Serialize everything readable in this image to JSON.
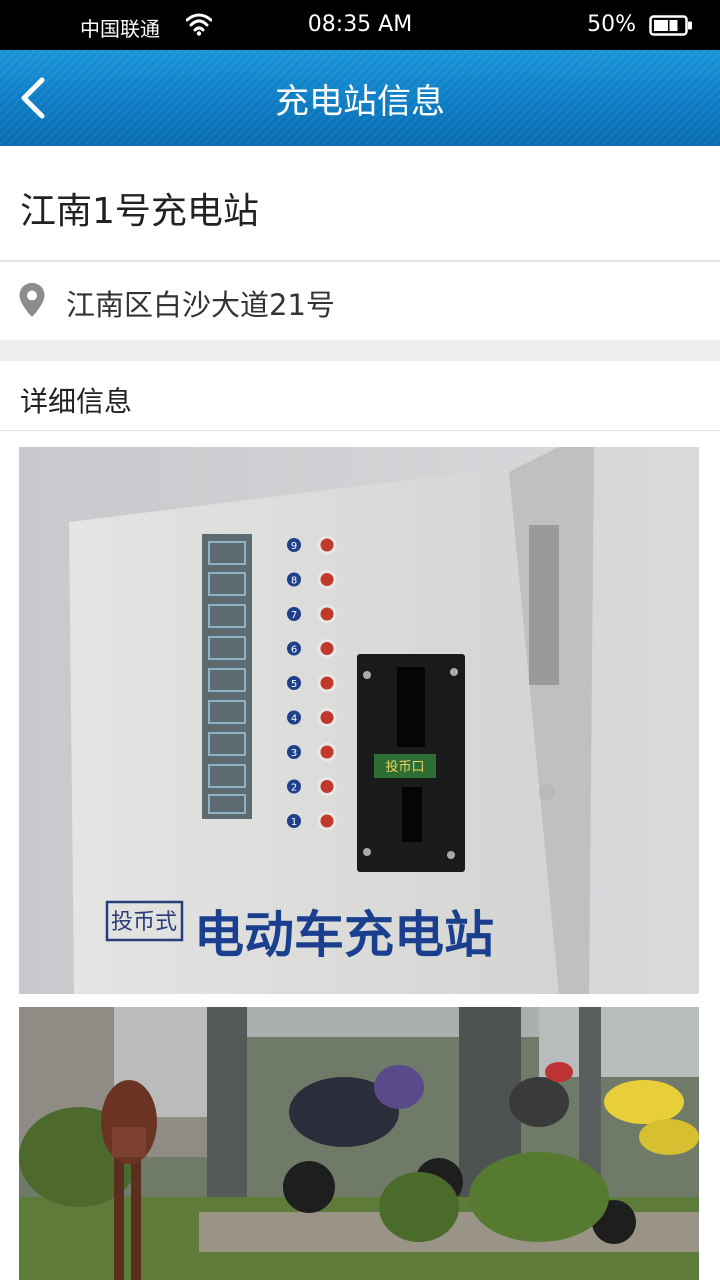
{
  "status_bar": {
    "carrier": "中国联通",
    "time": "08:35 AM",
    "battery_percent": "50%",
    "battery_level": 0.5
  },
  "nav": {
    "title": "充电站信息",
    "back_icon": "chevron-left-icon"
  },
  "station": {
    "name": "江南1号充电站",
    "address": "江南区白沙大道21号",
    "location_icon": "location-pin-icon"
  },
  "details": {
    "section_title": "详细信息",
    "photo1_sign_tag": "投币式",
    "photo1_sign_text": "电动车充电站",
    "photo1_coin_label": "投币口",
    "photo1_buttons": [
      "9",
      "8",
      "7",
      "6",
      "5",
      "4",
      "3",
      "2",
      "1"
    ]
  },
  "colors": {
    "nav_bar": "#0d7cc4",
    "status_bar": "#000000",
    "divider": "#e6e6e6",
    "section_gap": "#eeeeee",
    "sign_text": "#1b3f8f"
  }
}
